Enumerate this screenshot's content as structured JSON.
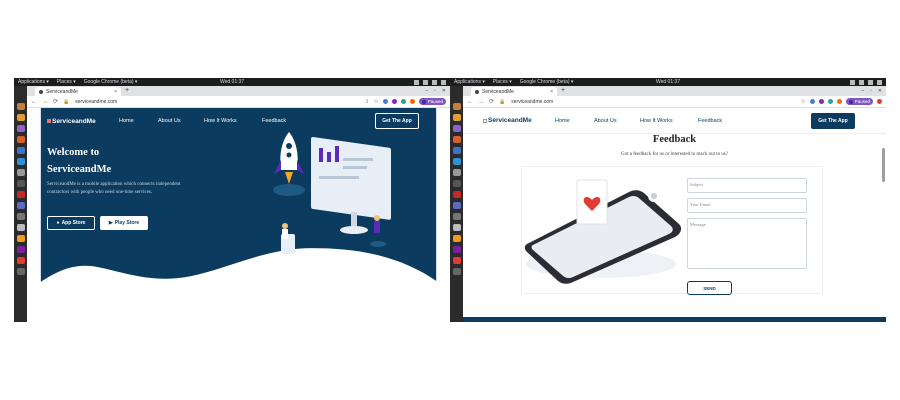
{
  "desktop": {
    "applications": "Applications ▾",
    "places": "Places ▾",
    "running_app": "Google Chrome (beta) ▾",
    "clock": "Wed 01:37"
  },
  "browser": {
    "tab_title": "ServiceandMe",
    "tab_close": "×",
    "new_tab": "+",
    "url": "serviceandme.com",
    "paused_label": "Paused",
    "paused_initial": "S"
  },
  "site": {
    "logo_text": "ServiceandMe",
    "nav": [
      "Home",
      "About Us",
      "How It Works",
      "Feedback"
    ],
    "get_app": "Get The App"
  },
  "hero": {
    "title_line1": "Welcome to",
    "title_line2": "ServiceandMe",
    "description": "ServiceandMe is a mobile application which connects independent contractors with people who need one-time services.",
    "app_store": "App Store",
    "play_store": "Play Store"
  },
  "feedback": {
    "title": "Feedback",
    "subtitle": "Got a feedback for us or interested to reach out to us?",
    "subject_placeholder": "Subject",
    "email_placeholder": "Your Email",
    "message_placeholder": "Message",
    "send_label": "SEND"
  },
  "colors": {
    "navy": "#0b3b5e",
    "purple": "#5b2ab8",
    "accent_red": "#e53935"
  }
}
